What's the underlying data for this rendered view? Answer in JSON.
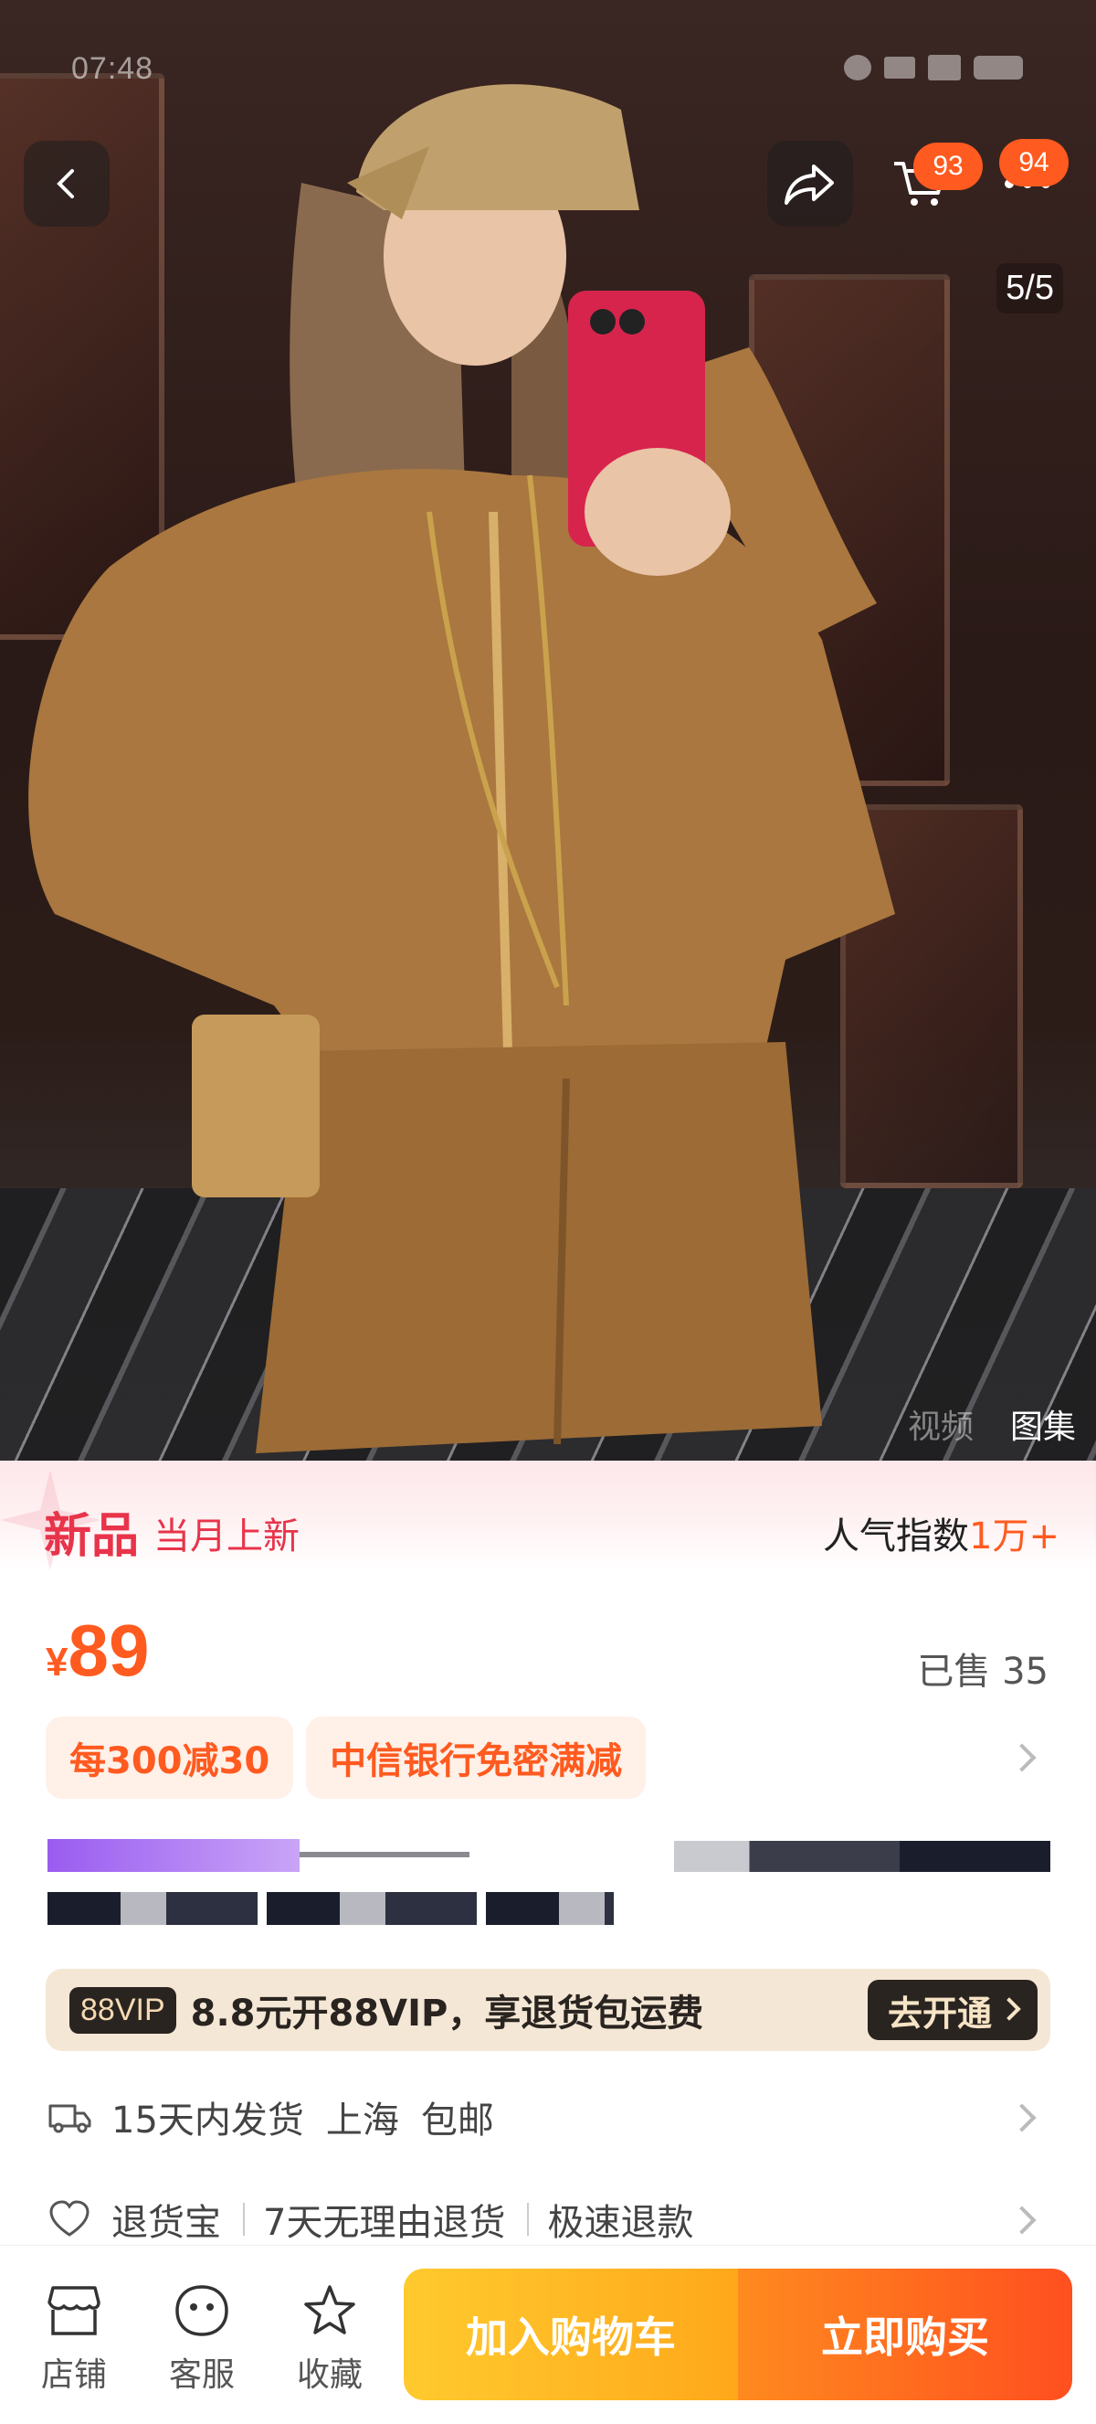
{
  "status_bar": {
    "time": "07:48"
  },
  "header": {
    "cart_badge": "93",
    "more_badge": "94"
  },
  "gallery": {
    "counter": "5/5",
    "tabs": [
      "视频",
      "图集"
    ],
    "active_tab": "图集"
  },
  "new_banner": {
    "tag": "新品",
    "subtitle": "当月上新",
    "popularity_label": "人气指数",
    "popularity_value": "1万+"
  },
  "price": {
    "currency": "¥",
    "amount": "89",
    "sold": "已售 35"
  },
  "promotions": [
    "每300减30",
    "中信银行免密满减"
  ],
  "vip": {
    "logo": "88VIP",
    "text": "8.8元开88VIP，享退货包运费",
    "button": "去开通"
  },
  "shipping": {
    "items": [
      "15天内发货",
      "上海",
      "包邮"
    ]
  },
  "returns": {
    "items": [
      "退货宝",
      "7天无理由退货",
      "极速退款"
    ]
  },
  "bottom_bar": {
    "tools": [
      "店铺",
      "客服",
      "收藏"
    ],
    "add_to_cart": "加入购物车",
    "buy_now": "立即购买"
  },
  "colors": {
    "accent": "#ff5a1f",
    "new_tag": "#e8344a",
    "cart_button": "#ffb51f",
    "buy_button": "#ff5a1f",
    "vip_dark": "#2a2420"
  }
}
